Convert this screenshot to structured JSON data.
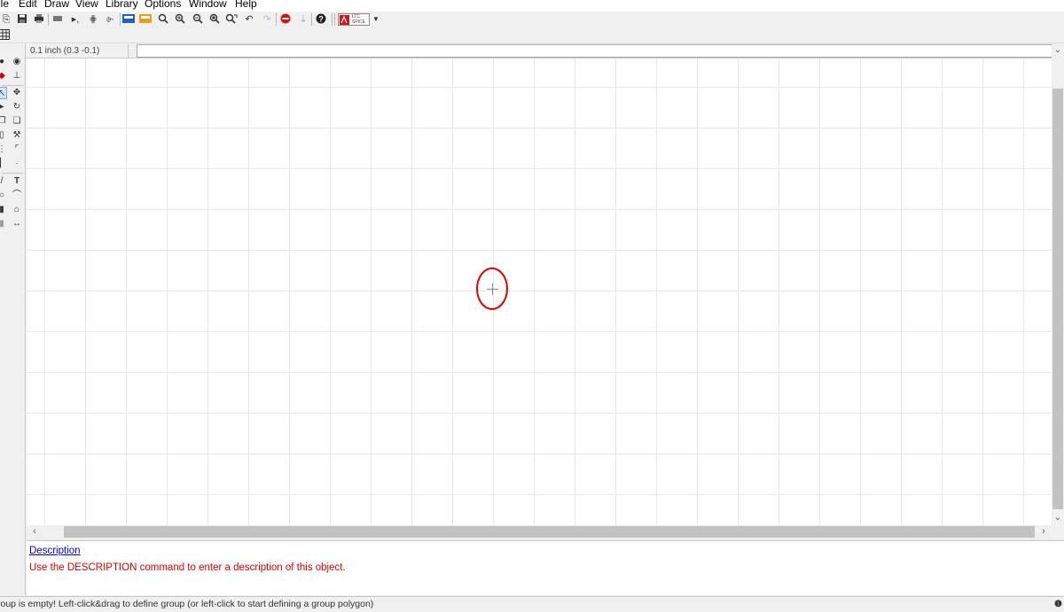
{
  "menu": {
    "file": "ile",
    "edit": "Edit",
    "draw": "Draw",
    "view": "View",
    "library": "Library",
    "options": "Options",
    "window": "Window",
    "help": "Help"
  },
  "toolbar": {
    "badge_line1": "LTC",
    "badge_line2": "SPICE",
    "dropdown": "▼"
  },
  "coordbar": {
    "grid_label": "0.1 inch (0.3 -0.1)",
    "command_value": ""
  },
  "description": {
    "link": "Description",
    "text": "Use the DESCRIPTION command to enter a description of this object."
  },
  "status": {
    "text": "roup is empty! Left-click&drag to define group (or left-click to start defining a group polygon)"
  },
  "colors": {
    "highlight_circle": "#e00000",
    "link": "#0000ee",
    "hint_text": "#e00000"
  }
}
